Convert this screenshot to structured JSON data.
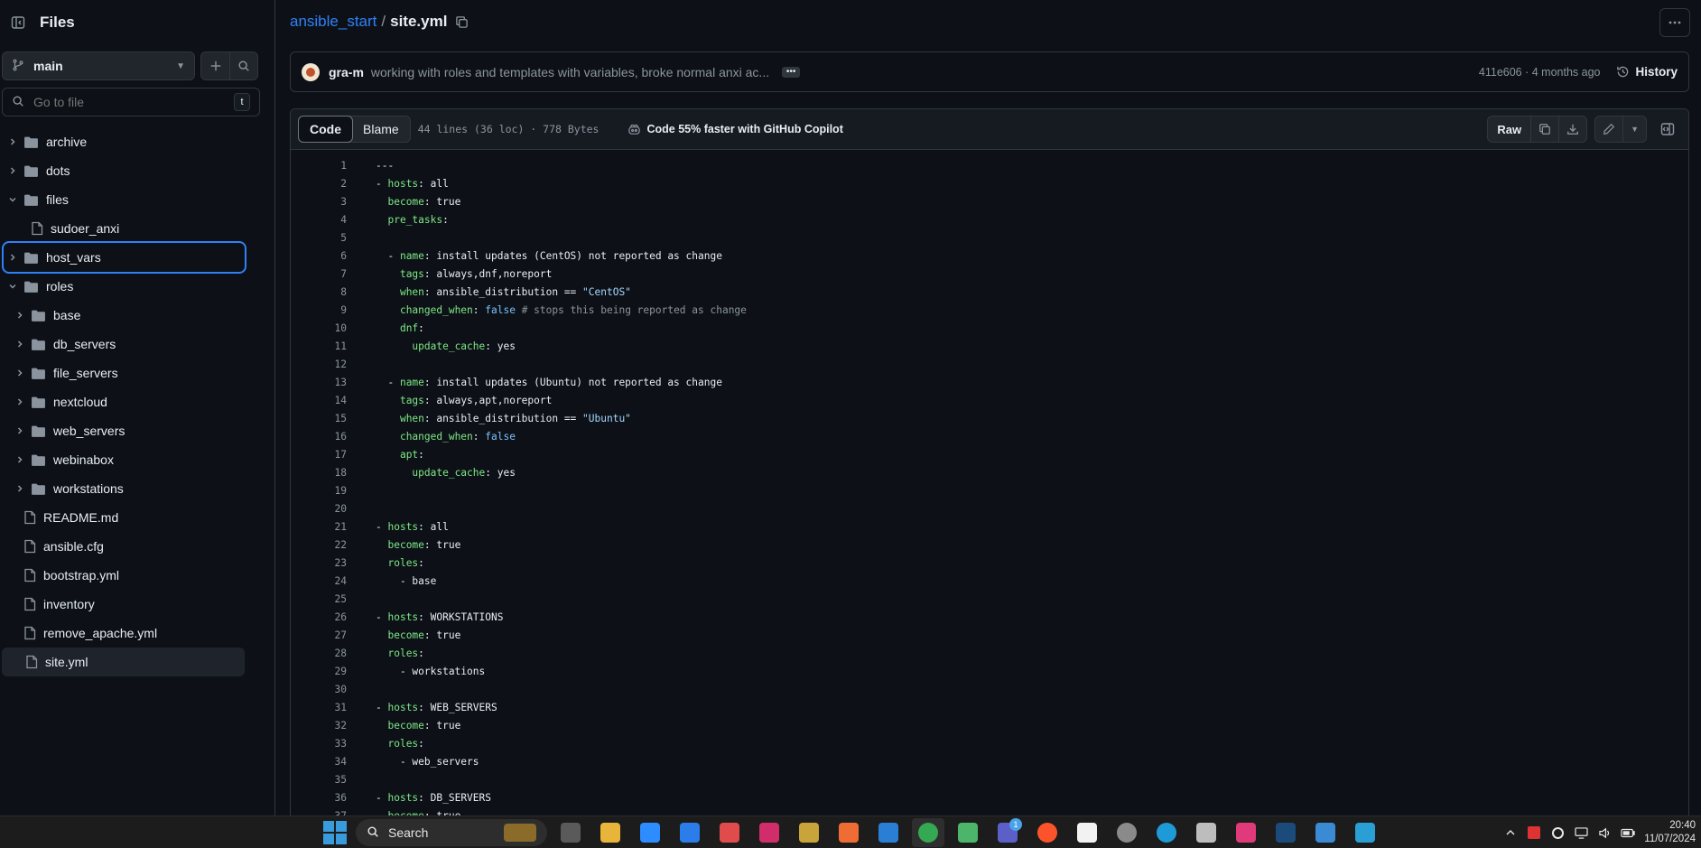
{
  "sidebar": {
    "title": "Files",
    "branch": "main",
    "goto_placeholder": "Go to file",
    "goto_shortcut": "t",
    "items": [
      {
        "label": "archive",
        "type": "folder",
        "depth": 0,
        "expanded": false
      },
      {
        "label": "dots",
        "type": "folder",
        "depth": 0,
        "expanded": false
      },
      {
        "label": "files",
        "type": "folder",
        "depth": 0,
        "expanded": true
      },
      {
        "label": "sudoer_anxi",
        "type": "file",
        "depth": 1
      },
      {
        "label": "host_vars",
        "type": "folder",
        "depth": 0,
        "expanded": false,
        "focused": true
      },
      {
        "label": "roles",
        "type": "folder",
        "depth": 0,
        "expanded": true
      },
      {
        "label": "base",
        "type": "folder",
        "depth": 1,
        "expanded": false
      },
      {
        "label": "db_servers",
        "type": "folder",
        "depth": 1,
        "expanded": false
      },
      {
        "label": "file_servers",
        "type": "folder",
        "depth": 1,
        "expanded": false
      },
      {
        "label": "nextcloud",
        "type": "folder",
        "depth": 1,
        "expanded": false
      },
      {
        "label": "web_servers",
        "type": "folder",
        "depth": 1,
        "expanded": false
      },
      {
        "label": "webinabox",
        "type": "folder",
        "depth": 1,
        "expanded": false
      },
      {
        "label": "workstations",
        "type": "folder",
        "depth": 1,
        "expanded": false
      },
      {
        "label": "README.md",
        "type": "file",
        "depth": 0
      },
      {
        "label": "ansible.cfg",
        "type": "file",
        "depth": 0
      },
      {
        "label": "bootstrap.yml",
        "type": "file",
        "depth": 0
      },
      {
        "label": "inventory",
        "type": "file",
        "depth": 0
      },
      {
        "label": "remove_apache.yml",
        "type": "file",
        "depth": 0
      },
      {
        "label": "site.yml",
        "type": "file",
        "depth": 0,
        "selected": true
      }
    ]
  },
  "breadcrumb": {
    "repo": "ansible_start",
    "separator": "/",
    "file": "site.yml"
  },
  "commit": {
    "author": "gra-m",
    "message": "working with roles and templates with variables, broke normal anxi ac...",
    "dots": "•••",
    "meta": "411e606 · 4 months ago",
    "history_label": "History"
  },
  "file_header": {
    "tab_code": "Code",
    "tab_blame": "Blame",
    "info": "44 lines (36 loc) · 778 Bytes",
    "copilot": "Code 55% faster with GitHub Copilot",
    "raw_label": "Raw"
  },
  "code_lines": [
    "---",
    "- hosts: all",
    "  become: true",
    "  pre_tasks:",
    "",
    "  - name: install updates (CentOS) not reported as change",
    "    tags: always,dnf,noreport",
    "    when: ansible_distribution == \"CentOS\"",
    "    changed_when: false # stops this being reported as change",
    "    dnf:",
    "      update_cache: yes",
    "",
    "  - name: install updates (Ubuntu) not reported as change",
    "    tags: always,apt,noreport",
    "    when: ansible_distribution == \"Ubuntu\"",
    "    changed_when: false",
    "    apt:",
    "      update_cache: yes",
    "",
    "",
    "- hosts: all",
    "  become: true",
    "  roles:",
    "    - base",
    "",
    "- hosts: WORKSTATIONS",
    "  become: true",
    "  roles:",
    "    - workstations",
    "",
    "- hosts: WEB_SERVERS",
    "  become: true",
    "  roles:",
    "    - web_servers",
    "",
    "- hosts: DB_SERVERS",
    "  become: true"
  ],
  "taskbar": {
    "search_label": "Search",
    "apps": [
      {
        "name": "task-view",
        "color": "#5a5a5a"
      },
      {
        "name": "file-explorer",
        "color": "#e8b53a"
      },
      {
        "name": "zoom",
        "color": "#2d8cff"
      },
      {
        "name": "webstorm",
        "color": "#2b7de9"
      },
      {
        "name": "app-colorful",
        "color": "#e04b4b"
      },
      {
        "name": "intellij",
        "color": "#d12d6b"
      },
      {
        "name": "app-yellow",
        "color": "#c9a43a"
      },
      {
        "name": "postman",
        "color": "#ef6c35"
      },
      {
        "name": "remote-desktop",
        "color": "#2a7fd4"
      },
      {
        "name": "chrome",
        "color": "#34a853",
        "active": true
      },
      {
        "name": "git-kraken",
        "color": "#4db56a"
      },
      {
        "name": "teams",
        "color": "#5b5fc7",
        "badge": "1"
      },
      {
        "name": "brave",
        "color": "#fb542b"
      },
      {
        "name": "notepad",
        "color": "#f2f2f2"
      },
      {
        "name": "settings",
        "color": "#8a8a8a"
      },
      {
        "name": "edge",
        "color": "#1e9bd7"
      },
      {
        "name": "app-gray",
        "color": "#bdbdbd"
      },
      {
        "name": "app-cube",
        "color": "#e03a7a"
      },
      {
        "name": "steam",
        "color": "#1b4b7a"
      },
      {
        "name": "app-a",
        "color": "#3a8bd4"
      },
      {
        "name": "photos",
        "color": "#2a9fd6"
      }
    ],
    "time": "20:40",
    "date": "11/07/2024"
  }
}
